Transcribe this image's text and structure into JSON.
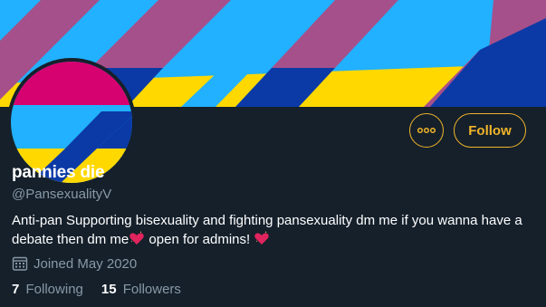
{
  "profile": {
    "display_name": "pannies die",
    "handle": "@PansexualityV",
    "bio_part1": "Anti-pan Supporting bisexuality and fighting pansexuality dm me if you wanna have a debate then dm me",
    "bio_part2": " open for admins! ",
    "joined": "Joined May 2020",
    "following_count": "7",
    "following_label": "Following",
    "followers_count": "15",
    "followers_label": "Followers"
  },
  "actions": {
    "follow_label": "Follow",
    "more_icon": "more-horizontal-icon"
  },
  "colors": {
    "background": "#15202b",
    "accent": "#f0b429",
    "muted_text": "#8899a6",
    "banner_blue": "#21b1ff",
    "banner_pink": "#a5508b",
    "banner_yellow": "#ffd800",
    "banner_navy": "#0b3aa6",
    "avatar_pink": "#d60270",
    "avatar_yellow": "#ffd800"
  },
  "icons": {
    "heart": "sparkling-heart-icon",
    "calendar": "calendar-icon"
  }
}
